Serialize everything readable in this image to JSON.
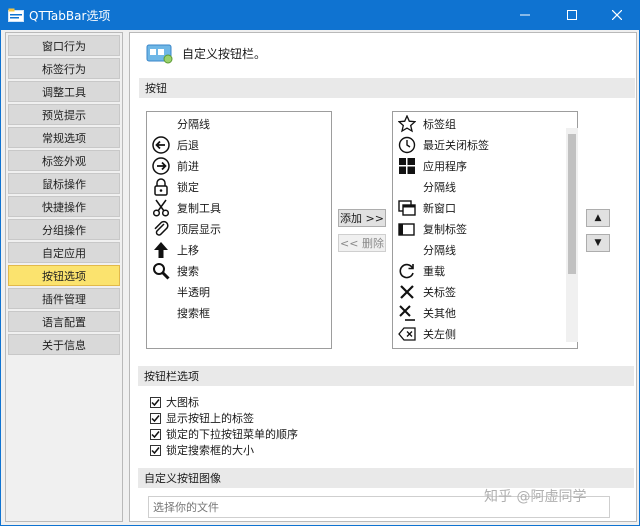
{
  "window": {
    "title": "QTTabBar选项"
  },
  "sidebar": {
    "items": [
      {
        "label": "窗口行为"
      },
      {
        "label": "标签行为"
      },
      {
        "label": "调整工具"
      },
      {
        "label": "预览提示"
      },
      {
        "label": "常规选项"
      },
      {
        "label": "标签外观"
      },
      {
        "label": "鼠标操作"
      },
      {
        "label": "快捷操作"
      },
      {
        "label": "分组操作"
      },
      {
        "label": "自定应用"
      },
      {
        "label": "按钮选项"
      },
      {
        "label": "插件管理"
      },
      {
        "label": "语言配置"
      },
      {
        "label": "关于信息"
      }
    ],
    "selected": "按钮选项"
  },
  "header": {
    "title": "自定义按钮栏。"
  },
  "sections": {
    "buttons": "按钮",
    "toolbar_options": "按钮栏选项",
    "custom_image": "自定义按钮图像"
  },
  "available_list": [
    {
      "label": "分隔线",
      "icon": "none"
    },
    {
      "label": "后退",
      "icon": "back-arrow-icon"
    },
    {
      "label": "前进",
      "icon": "forward-arrow-icon"
    },
    {
      "label": "锁定",
      "icon": "lock-icon"
    },
    {
      "label": "复制工具",
      "icon": "scissors-icon"
    },
    {
      "label": "顶层显示",
      "icon": "paperclip-icon"
    },
    {
      "label": "上移",
      "icon": "up-arrow-icon"
    },
    {
      "label": "搜索",
      "icon": "magnifier-icon"
    },
    {
      "label": "半透明",
      "icon": "none"
    },
    {
      "label": "搜索框",
      "icon": "none"
    }
  ],
  "current_list": [
    {
      "label": "标签组",
      "icon": "star-icon"
    },
    {
      "label": "最近关闭标签",
      "icon": "clock-icon"
    },
    {
      "label": "应用程序",
      "icon": "windows-logo-icon"
    },
    {
      "label": "分隔线",
      "icon": "none"
    },
    {
      "label": "新窗口",
      "icon": "new-window-icon"
    },
    {
      "label": "复制标签",
      "icon": "copy-tab-icon"
    },
    {
      "label": "分隔线",
      "icon": "none"
    },
    {
      "label": "重载",
      "icon": "reload-icon"
    },
    {
      "label": "关标签",
      "icon": "close-x-icon"
    },
    {
      "label": "关其他",
      "icon": "close-others-icon"
    },
    {
      "label": "关左侧",
      "icon": "close-left-icon"
    }
  ],
  "buttons": {
    "add": "添加 >>",
    "remove": "<< 删除",
    "up": "▲",
    "down": "▼"
  },
  "options": [
    {
      "label": "大图标",
      "checked": true
    },
    {
      "label": "显示按钮上的标签",
      "checked": true
    },
    {
      "label": "锁定的下拉按钮菜单的顺序",
      "checked": true
    },
    {
      "label": "锁定搜索框的大小",
      "checked": true
    }
  ],
  "file_input": {
    "placeholder": "选择你的文件"
  },
  "watermark": {
    "text": "知乎 @阿虚同学"
  },
  "colors": {
    "titlebar": "#0f73d1",
    "selected_item": "#fbe36e",
    "section_bg": "#e9e9e9"
  }
}
